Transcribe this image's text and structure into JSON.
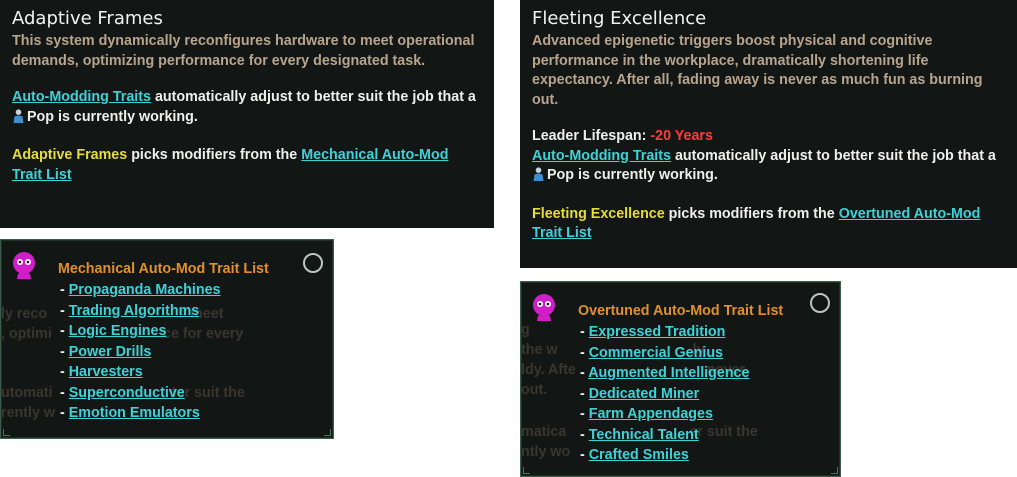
{
  "colors": {
    "panel_bg": "#121716",
    "link": "#3ed2d6",
    "trait_name": "#e6dc3a",
    "description": "#b8a48c",
    "negative": "#ff3a3a",
    "list_title": "#e1902a",
    "icon_magenta": "#d11fc8"
  },
  "left_tooltip": {
    "title": "Adaptive Frames",
    "description": "This system dynamically reconfigures hardware to meet operational demands, optimizing performance for every designated task.",
    "auto_link": "Auto-Modding Traits",
    "auto_text_1": " automatically adjust to better suit the job that a ",
    "pop_icon": "pop-icon",
    "auto_text_2": "Pop is currently working.",
    "trait_name": "Adaptive Frames",
    "picks_text": " picks modifiers from the ",
    "list_link": "Mechanical Auto-Mod Trait List"
  },
  "right_tooltip": {
    "title": "Fleeting Excellence",
    "description": "Advanced epigenetic triggers boost physical and cognitive performance in the workplace, dramatically shortening life expectancy. After all, fading away is never as much fun as burning out.",
    "lifespan_label": "Leader Lifespan: ",
    "lifespan_value": "-20 Years",
    "auto_link": "Auto-Modding Traits",
    "auto_text_1": " automatically adjust to better suit the job that a ",
    "pop_icon": "pop-icon",
    "auto_text_2": "Pop is currently working.",
    "trait_name": "Fleeting Excellence",
    "picks_text": " picks modifiers from the ",
    "list_link": "Overtuned Auto-Mod Trait List"
  },
  "left_list": {
    "icon": "magenta-trait-icon",
    "title": "Mechanical Auto-Mod Trait List",
    "dash": "- ",
    "items": [
      "Propaganda Machines",
      "Trading Algorithms",
      "Logic Engines",
      "Power Drills",
      "Harvesters",
      "Superconductive",
      "Emotion Emulators"
    ]
  },
  "right_list": {
    "icon": "magenta-trait-icon",
    "title": "Overtuned Auto-Mod Trait List",
    "dash": "- ",
    "items": [
      "Expressed Tradition",
      "Commercial Genius",
      "Augmented Intelligence",
      "Dedicated Miner",
      "Farm Appendages",
      "Technical Talent",
      "Crafted Smiles"
    ]
  }
}
